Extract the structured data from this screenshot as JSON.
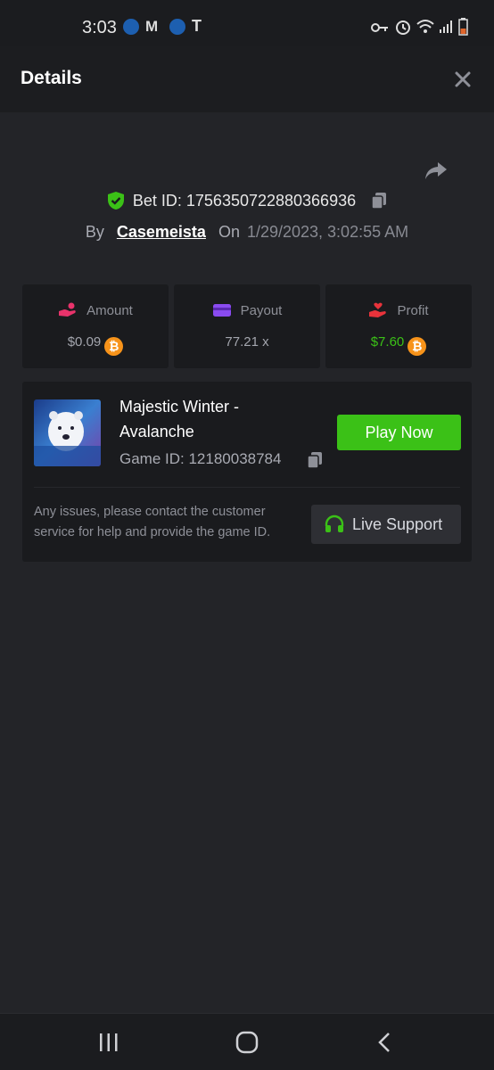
{
  "status_bar": {
    "time": "3:03",
    "notification_icons": [
      "app-icon",
      "gmail-icon",
      "app-icon",
      "t-icon"
    ],
    "status_icons": [
      "key-icon",
      "alarm-icon",
      "wifi-icon",
      "signal-icon",
      "battery-icon"
    ]
  },
  "header": {
    "title": "Details"
  },
  "bet": {
    "id_label": "Bet ID: 1756350722880366936",
    "by_label": "By",
    "username": "Casemeista",
    "on_label": "On",
    "date": "1/29/2023, 3:02:55 AM"
  },
  "stats": [
    {
      "label": "Amount",
      "value": "$0.09",
      "icon": "hand-coin-icon",
      "icon_color": "#e8336b"
    },
    {
      "label": "Payout",
      "value": "77.21 x",
      "icon": "card-icon",
      "icon_color": "#8a4bf0"
    },
    {
      "label": "Profit",
      "value": "$7.60",
      "icon": "hand-heart-icon",
      "icon_color": "#e8333b"
    }
  ],
  "game": {
    "name": "Majestic Winter - Avalanche",
    "thumb_text": "MAJESTIC WINTER AVALANCHE",
    "game_id": "Game ID: 12180038784",
    "play_label": "Play Now",
    "help_text": "Any issues, please contact the customer service for help and provide the game ID.",
    "support_label": "Live Support"
  },
  "colors": {
    "accent_green": "#3bc117",
    "bitcoin": "#f7931a",
    "background": "#232428",
    "card": "#1a1b1e"
  }
}
